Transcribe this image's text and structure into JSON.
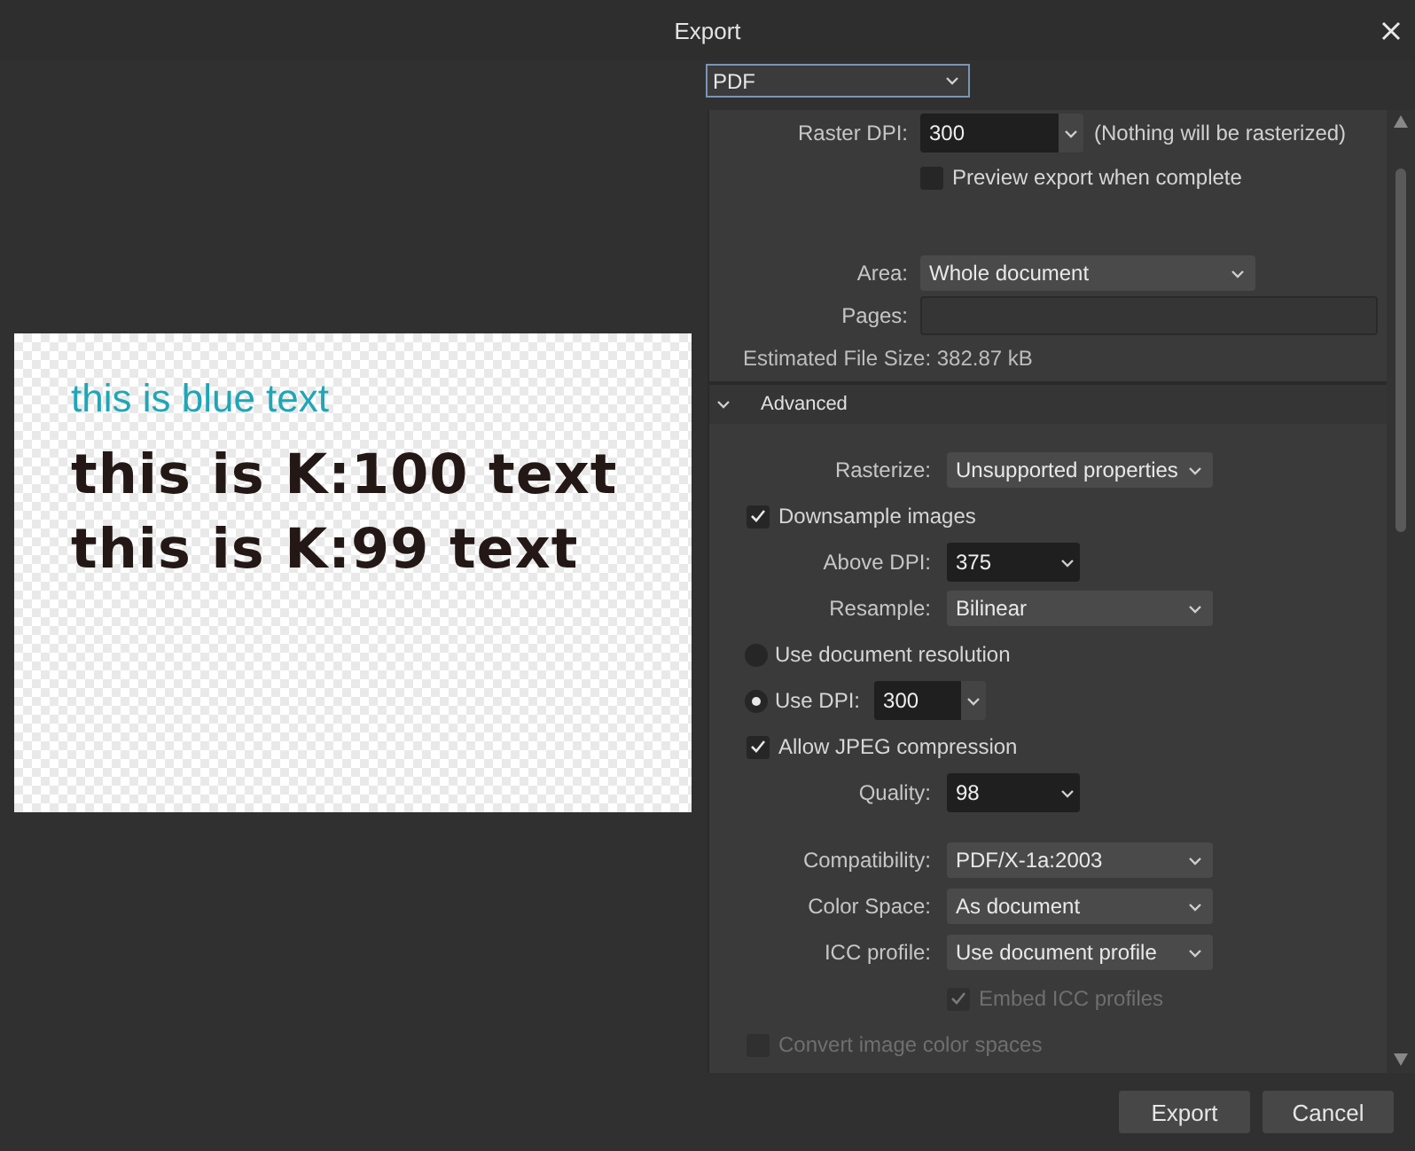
{
  "window": {
    "title": "Export"
  },
  "format": {
    "value": "PDF"
  },
  "preview": {
    "lines": [
      {
        "text": "this is blue text",
        "kind": "regular",
        "color": "#1fa6b6"
      },
      {
        "text": "this is K:100 text",
        "kind": "heavy",
        "color": "#231815"
      },
      {
        "text": "this is K:99 text",
        "kind": "heavy",
        "color": "#231815"
      }
    ]
  },
  "settings": {
    "sections": [
      {
        "rows": [
          {
            "kind": "combo",
            "label": "Raster DPI:",
            "value": "300",
            "note": "(Nothing will be rasterized)"
          },
          {
            "kind": "checkbox",
            "label": "Preview export when complete",
            "checked": false,
            "disabled": false,
            "nested": true
          },
          {
            "kind": "select",
            "label": "Area:",
            "value": "Whole document"
          },
          {
            "kind": "field",
            "label": "Pages:"
          },
          {
            "kind": "info",
            "text": "Estimated File Size: 382.87 kB"
          }
        ]
      },
      {
        "header": "Advanced",
        "expanded": true,
        "rows": [
          {
            "kind": "select",
            "label": "Rasterize:",
            "value": "Unsupported properties"
          },
          {
            "kind": "checkbox",
            "label": "Downsample images",
            "checked": true,
            "disabled": false,
            "nested": false
          },
          {
            "kind": "combo",
            "label": "Above DPI:",
            "value": "375"
          },
          {
            "kind": "select",
            "label": "Resample:",
            "value": "Bilinear"
          },
          {
            "kind": "radio",
            "label": "Use document resolution",
            "selected": false
          },
          {
            "kind": "radio",
            "label": "Use DPI:",
            "selected": true,
            "value": "300"
          },
          {
            "kind": "checkbox",
            "label": "Allow JPEG compression",
            "checked": true,
            "disabled": false,
            "nested": false
          },
          {
            "kind": "combo",
            "label": "Quality:",
            "value": "98"
          },
          {
            "kind": "select",
            "label": "Compatibility:",
            "value": "PDF/X-1a:2003"
          },
          {
            "kind": "select",
            "label": "Color Space:",
            "value": "As document"
          },
          {
            "kind": "select",
            "label": "ICC profile:",
            "value": "Use document profile"
          },
          {
            "kind": "checkbox",
            "label": "Embed ICC profiles",
            "checked": true,
            "disabled": true,
            "nested": true
          },
          {
            "kind": "checkbox",
            "label": "Convert image color spaces",
            "checked": false,
            "disabled": true,
            "nested": false
          }
        ]
      }
    ]
  },
  "buttons": [
    {
      "label": "Export"
    },
    {
      "label": "Cancel"
    }
  ]
}
